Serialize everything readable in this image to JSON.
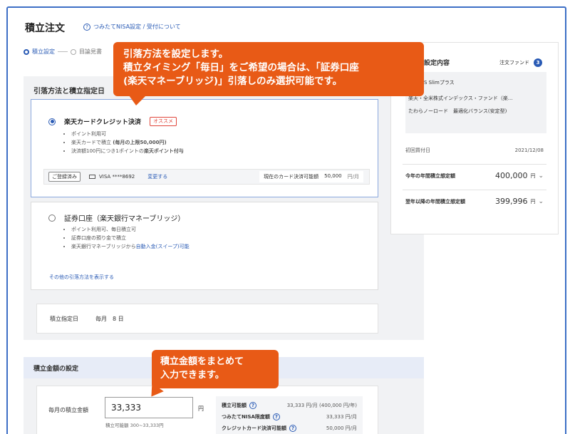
{
  "header": {
    "title": "積立注文",
    "help_link": "つみたてNISA設定 / 受付について"
  },
  "steps": {
    "step1": "積立設定",
    "step2": "目論見書"
  },
  "payment": {
    "section_title": "引落方法と積立指定日",
    "option1": {
      "title": "楽天カードクレジット決済",
      "badge": "オススメ",
      "bullets": [
        "ポイント利用可",
        "楽天カードで積立",
        "決済額100円につき1ポイントの"
      ],
      "bullet2_strong": "(毎月の上限50,000円)",
      "bullet3_strong": "楽天ポイント付与",
      "registered_tag": "ご登録済み",
      "card_number": "VISA ****8692",
      "change_link": "変更する",
      "available_label": "現在のカード決済可能額",
      "available_value": "50,000",
      "available_unit": "円/月"
    },
    "option2": {
      "title": "証券口座（楽天銀行マネーブリッジ）",
      "bullets": [
        "ポイント利用可、毎日積立可",
        "証券口座の預り金で積立",
        "楽天銀行マネーブリッジから"
      ],
      "bullet3_link": "自動入金(スイープ)可能"
    },
    "more_link": "その他の引落方法を表示する"
  },
  "date": {
    "label": "積立指定日",
    "value": "毎月　8 日"
  },
  "amount": {
    "section_title": "積立金額の設定",
    "label": "毎月の積立金額",
    "value": "33,333",
    "unit": "円",
    "hint": "積立可能額 300~33,333円",
    "limits": [
      {
        "label": "積立可能額",
        "value": "33,333 円/月 (400,000 円/年)"
      },
      {
        "label": "つみたてNISA限度額",
        "value": "33,333 円/月"
      },
      {
        "label": "クレジットカード決済可能額",
        "value": "50,000 円/月"
      }
    ]
  },
  "summary": {
    "heading": "設定内容",
    "fund_label": "注文ファンド",
    "fund_count": "3",
    "funds": [
      "eMAXIS Slimプラス",
      "楽天・全米株式インデックス・ファンド（楽...",
      "たわらノーロード　最適化バランス(安定型)"
    ],
    "first_buy_label": "初回買付日",
    "first_buy_value": "2021/12/08",
    "annual_label": "今年の年間積立想定額",
    "annual_value": "400,000",
    "next_label": "翌年以降の年間積立想定額",
    "next_value": "399,996",
    "yen": "円"
  },
  "callouts": {
    "top_line1": "引落方法を設定します。",
    "top_line2": "積立タイミング「毎日」をご希望の場合は、「証券口座",
    "top_line3": "(楽天マネーブリッジ)」引落しのみ選択可能です。",
    "bottom_line1": "積立金額をまとめて",
    "bottom_line2": "入力できます。"
  },
  "colors": {
    "accent": "#2a5bb5",
    "callout": "#e85a16",
    "badge": "#e0463b"
  }
}
